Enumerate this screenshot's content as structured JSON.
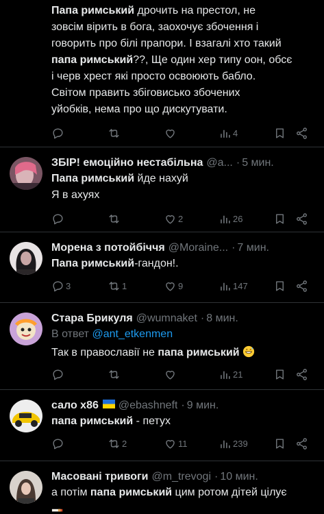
{
  "posts": [
    {
      "id": "p0",
      "name": "",
      "handle": "",
      "time": "",
      "text_segments": [
        {
          "bold": "Папа римський",
          "rest": " дрочить на престол, не"
        },
        {
          "bold": "",
          "rest": "зовсім вірить в бога, заохочує збочення і"
        },
        {
          "bold": "",
          "rest": "говорить про білі прапори. І взагалі хто такий"
        },
        {
          "bold": "папа римський",
          "rest": "??, Ще один хер типу оон, обсє"
        },
        {
          "bold": "",
          "rest": "і черв хрест які просто освоюють бабло."
        },
        {
          "bold": "",
          "rest": "Світом править збіговисько збочених"
        },
        {
          "bold": "",
          "rest": "уйобків, нема про що дискутувати."
        }
      ],
      "replies": "",
      "retweets": "",
      "likes": "",
      "views": "4"
    },
    {
      "id": "p1",
      "name": "ЗБІР! емоційно нестабільна",
      "handle": "@a...",
      "time": "5 мин.",
      "text_segments": [
        {
          "bold": "Папа римський",
          "rest": " йде нахуй"
        },
        {
          "bold": "",
          "rest": "Я в ахуях"
        }
      ],
      "replies": "",
      "retweets": "",
      "likes": "2",
      "views": "26"
    },
    {
      "id": "p2",
      "name": "Морена з потойбіччя",
      "handle": "@Moraine...",
      "time": "7 мин.",
      "text_segments": [
        {
          "bold": "Папа римський",
          "rest": "-гандон!."
        }
      ],
      "replies": "3",
      "retweets": "1",
      "likes": "9",
      "views": "147"
    },
    {
      "id": "p3",
      "name": "Стара Брикуля",
      "handle": "@wumnaket",
      "time": "8 мин.",
      "reply_prefix": "В ответ ",
      "reply_handle": "@ant_etkenmen",
      "text_segments": [
        {
          "rest": "Так в православії не ",
          "bold": "папа римський"
        }
      ],
      "replies": "",
      "retweets": "",
      "likes": "",
      "views": "21"
    },
    {
      "id": "p4",
      "name": "сало x86",
      "handle": "@ebashneft",
      "time": "9 мин.",
      "text_segments": [
        {
          "bold": "папа римський",
          "rest": " - петух"
        }
      ],
      "replies": "",
      "retweets": "2",
      "likes": "11",
      "views": "239"
    },
    {
      "id": "p5",
      "name": "Масовані тривоги",
      "handle": "@m_trevogi",
      "time": "10 мин.",
      "text_segments": [
        {
          "rest": "а потім ",
          "bold": "папа римський",
          "tail": " цим ротом дітей цілує"
        }
      ]
    }
  ],
  "icons": {
    "reply": "reply-icon",
    "retweet": "retweet-icon",
    "like": "like-icon",
    "views": "views-icon",
    "bookmark": "bookmark-icon",
    "share": "share-icon"
  },
  "colors": {
    "background": "#000000",
    "text": "#e7e9ea",
    "muted": "#71767b",
    "link": "#1d9bf0",
    "divider": "#2f3336"
  }
}
